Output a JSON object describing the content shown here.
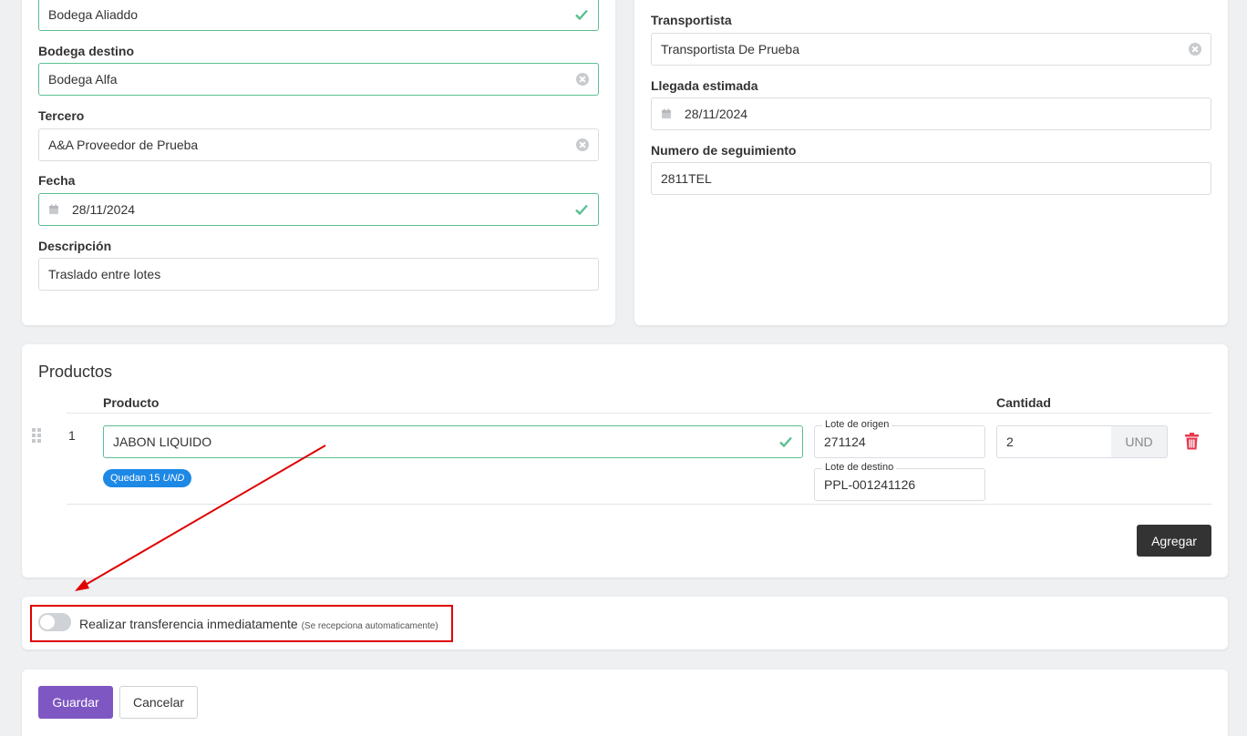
{
  "left_form": {
    "bodega_origen_value": "Bodega Aliaddo",
    "bodega_destino_label": "Bodega destino",
    "bodega_destino_value": "Bodega Alfa",
    "tercero_label": "Tercero",
    "tercero_value": "A&A Proveedor de Prueba",
    "fecha_label": "Fecha",
    "fecha_value": "28/11/2024",
    "descripcion_label": "Descripción",
    "descripcion_value": "Traslado entre lotes"
  },
  "right_form": {
    "transportista_label": "Transportista",
    "transportista_value": "Transportista De Prueba",
    "llegada_label": "Llegada estimada",
    "llegada_value": "28/11/2024",
    "seguimiento_label": "Numero de seguimiento",
    "seguimiento_value": "2811TEL"
  },
  "productos": {
    "title": "Productos",
    "col_producto": "Producto",
    "col_cantidad": "Cantidad",
    "rows": [
      {
        "index": "1",
        "producto": "JABON LIQUIDO",
        "badge_prefix": "Quedan 15",
        "badge_unit": "UND",
        "lote_origen_label": "Lote de origen",
        "lote_origen_value": "271124",
        "lote_destino_label": "Lote de destino",
        "lote_destino_value": "PPL-001241126",
        "cantidad": "2",
        "unidad": "UND"
      }
    ],
    "add_label": "Agregar"
  },
  "transfer_toggle": {
    "label": "Realizar transferencia inmediatamente",
    "hint": "(Se recepciona automaticamente)",
    "enabled": false
  },
  "actions": {
    "save_label": "Guardar",
    "cancel_label": "Cancelar"
  },
  "colors": {
    "accent": "#7e57c2",
    "success": "#5cbf91",
    "badge": "#1e88e5",
    "danger": "#e53950",
    "dark_button": "#333333",
    "annotation": "#e00000"
  },
  "icons": [
    "check-icon",
    "clear-icon",
    "calendar-icon",
    "drag-handle-icon",
    "trash-icon"
  ]
}
